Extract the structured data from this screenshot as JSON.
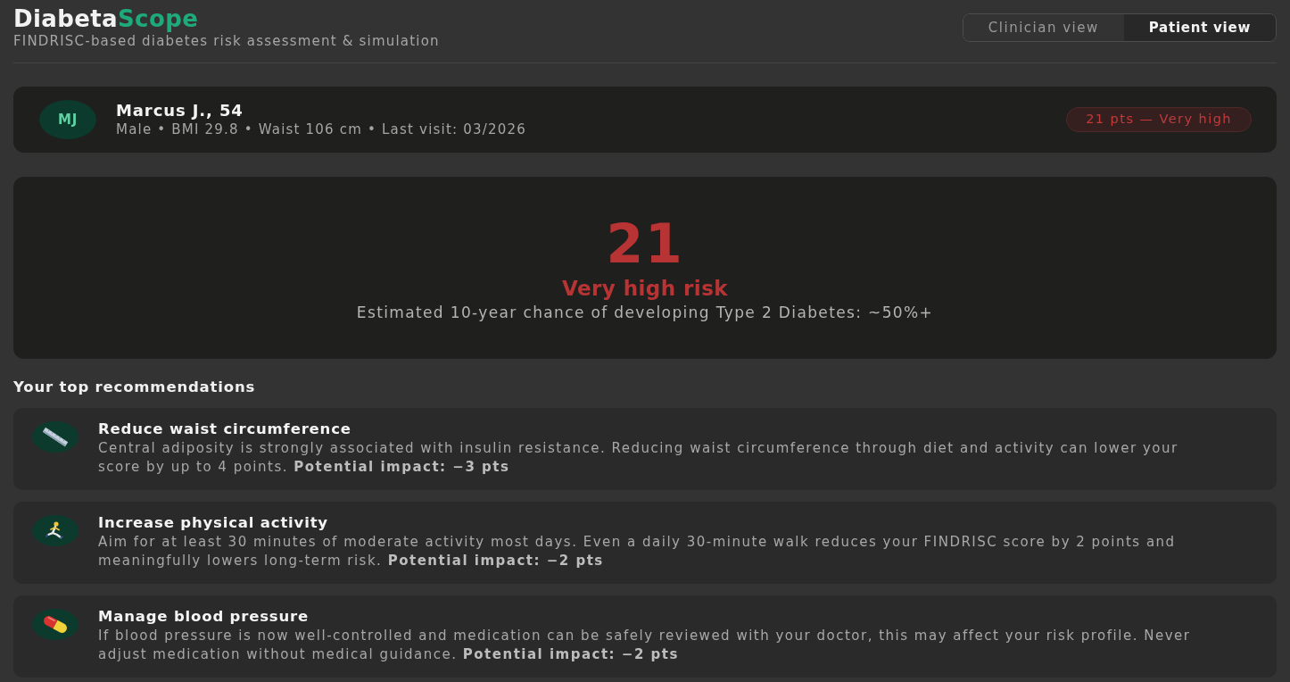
{
  "header": {
    "logo": {
      "text": "Diabeta",
      "accent": "Scope"
    },
    "subtitle": "FINDRISC-based diabetes risk assessment & simulation"
  },
  "view_tabs": [
    {
      "label": "Clinician view",
      "selected": false
    },
    {
      "label": "Patient view",
      "selected": true
    }
  ],
  "patient": {
    "initials": "MJ",
    "name": "Marcus J., 54",
    "details": "Male • BMI 29.8 • Waist 106 cm • Last visit: 03/2026",
    "badge": "21 pts — Very high"
  },
  "score_card": {
    "score": "21",
    "risk_label": "Very high risk",
    "estimate": "Estimated 10-year chance of developing Type 2 Diabetes: ~50%+"
  },
  "recommendations": {
    "heading": "Your top recommendations",
    "items": [
      {
        "title": "Reduce waist circumference",
        "text": "Central adiposity is strongly associated with insulin resistance. Reducing waist circumference through diet and activity can lower your score by up to 4 points. **Potential impact: −3 pts**"
      },
      {
        "title": "Increase physical activity",
        "text": "Aim for at least 30 minutes of moderate activity most days. Even a daily 30-minute walk reduces your FINDRISC score by 2 points and meaningfully lowers long-term risk. **Potential impact: −2 pts**"
      },
      {
        "title": "Manage blood pressure",
        "text": "If blood pressure is now well-controlled and medication can be safely reviewed with your doctor, this may affect your risk profile. Never adjust medication without medical guidance. **Potential impact: −2 pts**"
      }
    ]
  }
}
